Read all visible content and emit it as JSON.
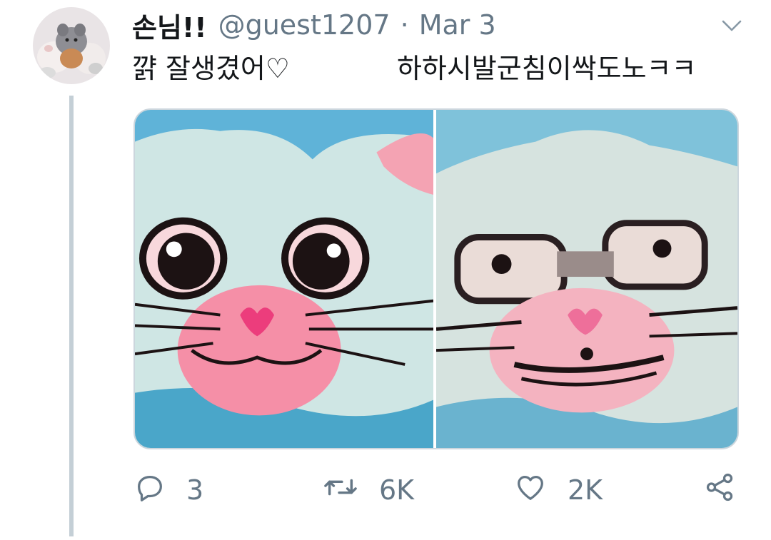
{
  "tweet": {
    "author": {
      "display_name": "손님!!",
      "handle": "@guest1207"
    },
    "separator": "·",
    "date": "Mar 3",
    "text_part1": "꺍 잘생겼어♡",
    "text_part2": "하하시발군침이싹도노ㅋㅋ",
    "icons": {
      "more": "chevron-down-icon",
      "reply": "reply-icon",
      "retweet": "retweet-icon",
      "like": "heart-icon",
      "share": "share-icon"
    },
    "actions": {
      "reply_count": "3",
      "retweet_count": "6K",
      "like_count": "2K"
    },
    "colors": {
      "text": "#14171a",
      "secondary": "#657786",
      "thread_line": "#c4cfd6",
      "border": "#ccd6dd"
    }
  }
}
